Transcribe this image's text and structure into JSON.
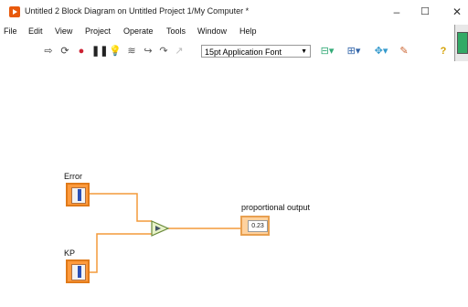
{
  "window": {
    "title": "Untitled 2 Block Diagram on Untitled Project 1/My Computer *",
    "minimize": "–",
    "maximize": "☐",
    "close": "✕"
  },
  "menu": [
    {
      "label": "File"
    },
    {
      "label": "Edit"
    },
    {
      "label": "View"
    },
    {
      "label": "Project"
    },
    {
      "label": "Operate"
    },
    {
      "label": "Tools"
    },
    {
      "label": "Window"
    },
    {
      "label": "Help"
    }
  ],
  "toolbar": {
    "font": "15pt Application Font"
  },
  "diagram": {
    "error_label": "Error",
    "kp_label": "KP",
    "output_label": "proportional output",
    "output_value": "0.23"
  },
  "colors": {
    "terminal_orange": "#ff9a3c",
    "wire_orange": "#f39a3a",
    "multiply_green": "#e7f2c8"
  }
}
